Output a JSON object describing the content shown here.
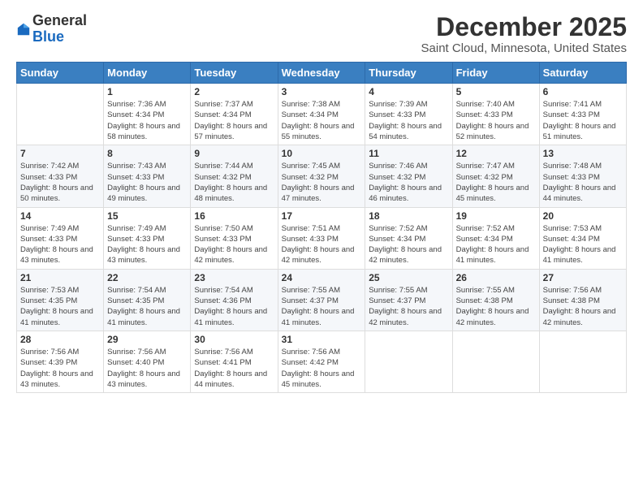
{
  "header": {
    "logo_general": "General",
    "logo_blue": "Blue",
    "month_title": "December 2025",
    "location": "Saint Cloud, Minnesota, United States"
  },
  "weekdays": [
    "Sunday",
    "Monday",
    "Tuesday",
    "Wednesday",
    "Thursday",
    "Friday",
    "Saturday"
  ],
  "weeks": [
    [
      {
        "day": "",
        "sunrise": "",
        "sunset": "",
        "daylight": ""
      },
      {
        "day": "1",
        "sunrise": "Sunrise: 7:36 AM",
        "sunset": "Sunset: 4:34 PM",
        "daylight": "Daylight: 8 hours and 58 minutes."
      },
      {
        "day": "2",
        "sunrise": "Sunrise: 7:37 AM",
        "sunset": "Sunset: 4:34 PM",
        "daylight": "Daylight: 8 hours and 57 minutes."
      },
      {
        "day": "3",
        "sunrise": "Sunrise: 7:38 AM",
        "sunset": "Sunset: 4:34 PM",
        "daylight": "Daylight: 8 hours and 55 minutes."
      },
      {
        "day": "4",
        "sunrise": "Sunrise: 7:39 AM",
        "sunset": "Sunset: 4:33 PM",
        "daylight": "Daylight: 8 hours and 54 minutes."
      },
      {
        "day": "5",
        "sunrise": "Sunrise: 7:40 AM",
        "sunset": "Sunset: 4:33 PM",
        "daylight": "Daylight: 8 hours and 52 minutes."
      },
      {
        "day": "6",
        "sunrise": "Sunrise: 7:41 AM",
        "sunset": "Sunset: 4:33 PM",
        "daylight": "Daylight: 8 hours and 51 minutes."
      }
    ],
    [
      {
        "day": "7",
        "sunrise": "Sunrise: 7:42 AM",
        "sunset": "Sunset: 4:33 PM",
        "daylight": "Daylight: 8 hours and 50 minutes."
      },
      {
        "day": "8",
        "sunrise": "Sunrise: 7:43 AM",
        "sunset": "Sunset: 4:33 PM",
        "daylight": "Daylight: 8 hours and 49 minutes."
      },
      {
        "day": "9",
        "sunrise": "Sunrise: 7:44 AM",
        "sunset": "Sunset: 4:32 PM",
        "daylight": "Daylight: 8 hours and 48 minutes."
      },
      {
        "day": "10",
        "sunrise": "Sunrise: 7:45 AM",
        "sunset": "Sunset: 4:32 PM",
        "daylight": "Daylight: 8 hours and 47 minutes."
      },
      {
        "day": "11",
        "sunrise": "Sunrise: 7:46 AM",
        "sunset": "Sunset: 4:32 PM",
        "daylight": "Daylight: 8 hours and 46 minutes."
      },
      {
        "day": "12",
        "sunrise": "Sunrise: 7:47 AM",
        "sunset": "Sunset: 4:32 PM",
        "daylight": "Daylight: 8 hours and 45 minutes."
      },
      {
        "day": "13",
        "sunrise": "Sunrise: 7:48 AM",
        "sunset": "Sunset: 4:33 PM",
        "daylight": "Daylight: 8 hours and 44 minutes."
      }
    ],
    [
      {
        "day": "14",
        "sunrise": "Sunrise: 7:49 AM",
        "sunset": "Sunset: 4:33 PM",
        "daylight": "Daylight: 8 hours and 43 minutes."
      },
      {
        "day": "15",
        "sunrise": "Sunrise: 7:49 AM",
        "sunset": "Sunset: 4:33 PM",
        "daylight": "Daylight: 8 hours and 43 minutes."
      },
      {
        "day": "16",
        "sunrise": "Sunrise: 7:50 AM",
        "sunset": "Sunset: 4:33 PM",
        "daylight": "Daylight: 8 hours and 42 minutes."
      },
      {
        "day": "17",
        "sunrise": "Sunrise: 7:51 AM",
        "sunset": "Sunset: 4:33 PM",
        "daylight": "Daylight: 8 hours and 42 minutes."
      },
      {
        "day": "18",
        "sunrise": "Sunrise: 7:52 AM",
        "sunset": "Sunset: 4:34 PM",
        "daylight": "Daylight: 8 hours and 42 minutes."
      },
      {
        "day": "19",
        "sunrise": "Sunrise: 7:52 AM",
        "sunset": "Sunset: 4:34 PM",
        "daylight": "Daylight: 8 hours and 41 minutes."
      },
      {
        "day": "20",
        "sunrise": "Sunrise: 7:53 AM",
        "sunset": "Sunset: 4:34 PM",
        "daylight": "Daylight: 8 hours and 41 minutes."
      }
    ],
    [
      {
        "day": "21",
        "sunrise": "Sunrise: 7:53 AM",
        "sunset": "Sunset: 4:35 PM",
        "daylight": "Daylight: 8 hours and 41 minutes."
      },
      {
        "day": "22",
        "sunrise": "Sunrise: 7:54 AM",
        "sunset": "Sunset: 4:35 PM",
        "daylight": "Daylight: 8 hours and 41 minutes."
      },
      {
        "day": "23",
        "sunrise": "Sunrise: 7:54 AM",
        "sunset": "Sunset: 4:36 PM",
        "daylight": "Daylight: 8 hours and 41 minutes."
      },
      {
        "day": "24",
        "sunrise": "Sunrise: 7:55 AM",
        "sunset": "Sunset: 4:37 PM",
        "daylight": "Daylight: 8 hours and 41 minutes."
      },
      {
        "day": "25",
        "sunrise": "Sunrise: 7:55 AM",
        "sunset": "Sunset: 4:37 PM",
        "daylight": "Daylight: 8 hours and 42 minutes."
      },
      {
        "day": "26",
        "sunrise": "Sunrise: 7:55 AM",
        "sunset": "Sunset: 4:38 PM",
        "daylight": "Daylight: 8 hours and 42 minutes."
      },
      {
        "day": "27",
        "sunrise": "Sunrise: 7:56 AM",
        "sunset": "Sunset: 4:38 PM",
        "daylight": "Daylight: 8 hours and 42 minutes."
      }
    ],
    [
      {
        "day": "28",
        "sunrise": "Sunrise: 7:56 AM",
        "sunset": "Sunset: 4:39 PM",
        "daylight": "Daylight: 8 hours and 43 minutes."
      },
      {
        "day": "29",
        "sunrise": "Sunrise: 7:56 AM",
        "sunset": "Sunset: 4:40 PM",
        "daylight": "Daylight: 8 hours and 43 minutes."
      },
      {
        "day": "30",
        "sunrise": "Sunrise: 7:56 AM",
        "sunset": "Sunset: 4:41 PM",
        "daylight": "Daylight: 8 hours and 44 minutes."
      },
      {
        "day": "31",
        "sunrise": "Sunrise: 7:56 AM",
        "sunset": "Sunset: 4:42 PM",
        "daylight": "Daylight: 8 hours and 45 minutes."
      },
      {
        "day": "",
        "sunrise": "",
        "sunset": "",
        "daylight": ""
      },
      {
        "day": "",
        "sunrise": "",
        "sunset": "",
        "daylight": ""
      },
      {
        "day": "",
        "sunrise": "",
        "sunset": "",
        "daylight": ""
      }
    ]
  ]
}
